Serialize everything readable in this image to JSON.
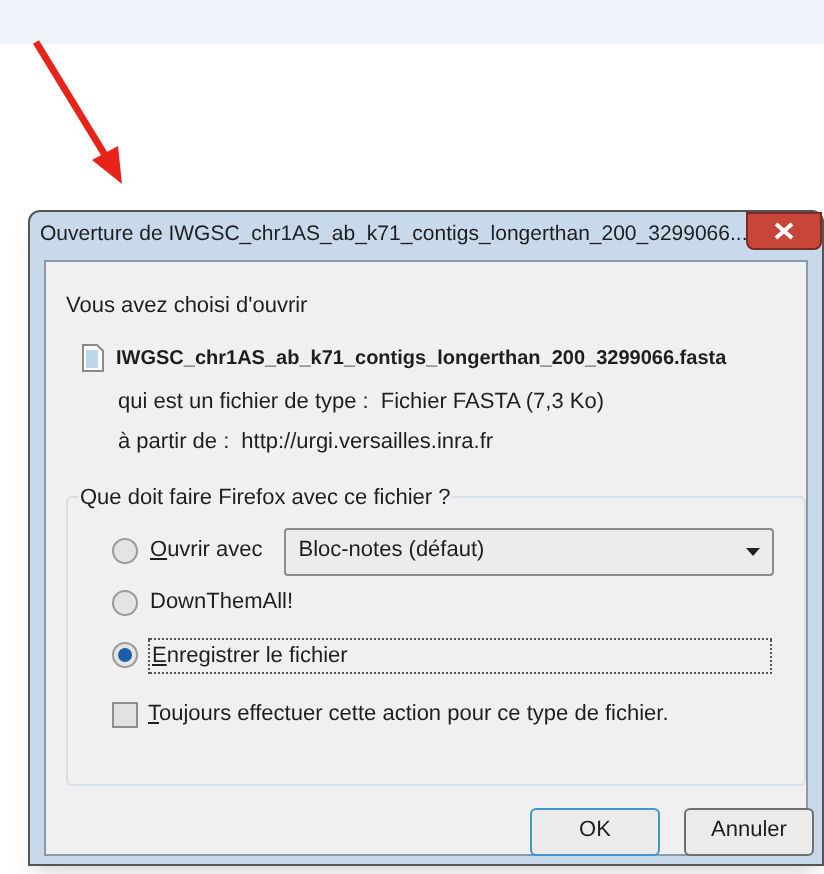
{
  "window": {
    "title": "Ouverture de IWGSC_chr1AS_ab_k71_contigs_longerthan_200_3299066..."
  },
  "intro": "Vous avez choisi d'ouvrir",
  "file": {
    "name": "IWGSC_chr1AS_ab_k71_contigs_longerthan_200_3299066.fasta",
    "type_label": "qui est un fichier de type :",
    "type_value": "Fichier FASTA (7,3 Ko)",
    "source_label": "à partir de :",
    "source_value": "http://urgi.versailles.inra.fr"
  },
  "group": {
    "legend": "Que doit faire Firefox avec ce fichier ?",
    "options": [
      {
        "label": "Ouvrir avec",
        "mnemonic": true,
        "selected": false,
        "dropdown": "Bloc-notes (défaut)"
      },
      {
        "label": "DownThemAll!",
        "mnemonic": false,
        "selected": false
      },
      {
        "label": "Enregistrer le fichier",
        "mnemonic": true,
        "selected": true
      }
    ],
    "always": {
      "label": "Toujours effectuer cette action pour ce type de fichier.",
      "mnemonic": true,
      "checked": false
    }
  },
  "buttons": [
    {
      "label": "OK",
      "default": true
    },
    {
      "label": "Annuler",
      "default": false
    }
  ]
}
